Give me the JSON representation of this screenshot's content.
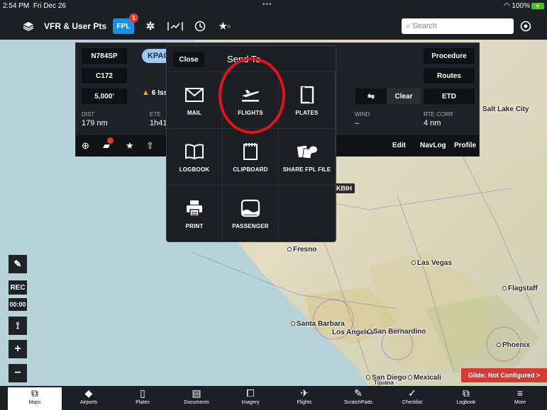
{
  "status_bar": {
    "time": "2:54 PM",
    "date": "Fri Dec 26",
    "battery": "100%"
  },
  "toolbar": {
    "layer_label": "VFR & User Pts",
    "fpl_label": "FPL",
    "fpl_badge": "1",
    "search_placeholder": "Search"
  },
  "flight_plan": {
    "tail": "N784SP",
    "aircraft": "C172",
    "altitude": "5,000'",
    "departure": "KPAO",
    "issues": "6 Iss",
    "procedure": "Procedure",
    "routes": "Routes",
    "etd": "ETD",
    "clear": "Clear",
    "stats": [
      {
        "label": "DIST",
        "value": "179 nm"
      },
      {
        "label": "ETE",
        "value": "1h41"
      },
      {
        "label": "WIND",
        "value": "–"
      },
      {
        "label": "RTE CORR",
        "value": "4 nm"
      }
    ],
    "edit": "Edit",
    "navlog": "NavLog",
    "profile": "Profile"
  },
  "send_to": {
    "close": "Close",
    "title": "Send To",
    "items": [
      {
        "label": "MAIL",
        "icon": "mail-icon"
      },
      {
        "label": "FLIGHTS",
        "icon": "flights-icon"
      },
      {
        "label": "PLATES",
        "icon": "plates-icon"
      },
      {
        "label": "LOGBOOK",
        "icon": "logbook-icon"
      },
      {
        "label": "CLIPBOARD",
        "icon": "clipboard-icon"
      },
      {
        "label": "SHARE FPL FILE",
        "icon": "share-fpl-icon"
      },
      {
        "label": "PRINT",
        "icon": "print-icon"
      },
      {
        "label": "PASSENGER",
        "icon": "passenger-icon"
      }
    ]
  },
  "map": {
    "labels": {
      "salt_lake_city": "Salt Lake City",
      "fresno": "Fresno",
      "las_vegas": "Las Vegas",
      "flagstaff": "Flagstaff",
      "santa_barbara": "Santa Barbara",
      "los_angeles": "Los Angeles",
      "san_bernardino": "San Bernardino",
      "phoenix": "Phoenix",
      "san_diego": "San Diego",
      "mexicali": "Mexicali",
      "tijuana": "Tijuana",
      "kbih": "KBIH"
    }
  },
  "side_controls": {
    "rec": "REC",
    "timer": "00:00"
  },
  "glide": "Glide: Not Configured >",
  "tabs": [
    {
      "label": "Maps",
      "icon": "map-book-icon"
    },
    {
      "label": "Airports",
      "icon": "airport-icon"
    },
    {
      "label": "Plates",
      "icon": "plates-icon"
    },
    {
      "label": "Documents",
      "icon": "documents-icon"
    },
    {
      "label": "Imagery",
      "icon": "imagery-icon"
    },
    {
      "label": "Flights",
      "icon": "flights-icon"
    },
    {
      "label": "ScratchPads",
      "icon": "pencil-icon"
    },
    {
      "label": "Checklist",
      "icon": "checkmark-icon"
    },
    {
      "label": "Logbook",
      "icon": "logbook-icon"
    },
    {
      "label": "More",
      "icon": "menu-icon"
    }
  ],
  "colors": {
    "accent": "#1a8fe3",
    "alert": "#e53935",
    "glide": "#d63a34",
    "ring": "#e0141b"
  }
}
